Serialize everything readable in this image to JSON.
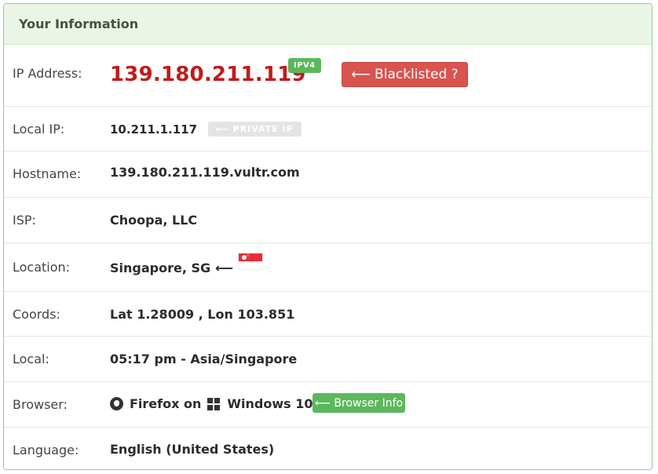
{
  "panel": {
    "title": "Your Information"
  },
  "rows": {
    "ip": {
      "label": "IP Address:",
      "value": "139.180.211.119",
      "badge": "IPV4",
      "button": "⟵ Blacklisted ?"
    },
    "local_ip": {
      "label": "Local IP:",
      "value": "10.211.1.117",
      "badge": "⟵ PRIVATE IP"
    },
    "hostname": {
      "label": "Hostname:",
      "value": "139.180.211.119.vultr.com"
    },
    "isp": {
      "label": "ISP:",
      "value": "Choopa, LLC"
    },
    "location": {
      "label": "Location:",
      "value": "Singapore, SG",
      "arrow": "⟵",
      "flag_icon": "singapore-flag-icon"
    },
    "coords": {
      "label": "Coords:",
      "value": "Lat 1.28009 , Lon 103.851"
    },
    "local": {
      "label": "Local:",
      "value": "05:17 pm - Asia/Singapore"
    },
    "browser": {
      "label": "Browser:",
      "browser_name": "Firefox on",
      "os_name": "Windows 10",
      "button": "⟵ Browser Info",
      "browser_icon": "firefox-icon",
      "os_icon": "windows-icon"
    },
    "language": {
      "label": "Language:",
      "value": "English (United States)"
    }
  },
  "colors": {
    "accent_green": "#5cb85c",
    "danger_red": "#d9534f",
    "ip_red": "#c11b1b",
    "heading_bg": "#eaf5e6"
  }
}
